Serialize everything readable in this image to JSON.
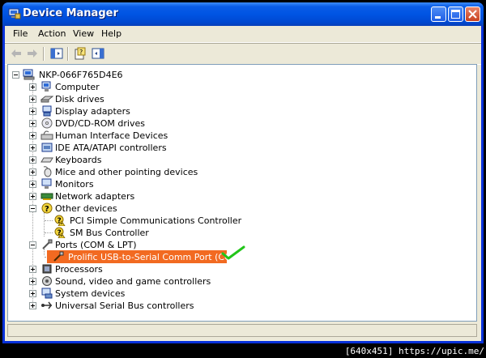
{
  "window": {
    "title": "Device Manager"
  },
  "menu": [
    "File",
    "Action",
    "View",
    "Help"
  ],
  "toolbar": {
    "icons": [
      "back-arrow-icon",
      "forward-arrow-icon",
      "show-hide-tree-icon",
      "properties-help-icon",
      "console-tree-icon"
    ]
  },
  "tree": {
    "root": "NKP-066F765D4E6",
    "items": [
      {
        "label": "Computer",
        "icon": "computer-icon"
      },
      {
        "label": "Disk drives",
        "icon": "disk-drive-icon"
      },
      {
        "label": "Display adapters",
        "icon": "display-adapter-icon"
      },
      {
        "label": "DVD/CD-ROM drives",
        "icon": "cdrom-icon"
      },
      {
        "label": "Human Interface Devices",
        "icon": "hid-icon"
      },
      {
        "label": "IDE ATA/ATAPI controllers",
        "icon": "ide-controller-icon"
      },
      {
        "label": "Keyboards",
        "icon": "keyboard-icon"
      },
      {
        "label": "Mice and other pointing devices",
        "icon": "mouse-icon"
      },
      {
        "label": "Monitors",
        "icon": "monitor-icon"
      },
      {
        "label": "Network adapters",
        "icon": "network-adapter-icon"
      },
      {
        "label": "Other devices",
        "icon": "unknown-device-icon"
      },
      {
        "label": "PCI Simple Communications Controller",
        "icon": "warning-device-icon"
      },
      {
        "label": "SM Bus Controller",
        "icon": "warning-device-icon"
      },
      {
        "label": "Ports (COM & LPT)",
        "icon": "port-icon"
      },
      {
        "label": "Prolific USB-to-Serial Comm Port (COM9)",
        "icon": "serial-port-icon"
      },
      {
        "label": "Processors",
        "icon": "processor-icon"
      },
      {
        "label": "Sound, video and game controllers",
        "icon": "sound-icon"
      },
      {
        "label": "System devices",
        "icon": "system-device-icon"
      },
      {
        "label": "Universal Serial Bus controllers",
        "icon": "usb-icon"
      }
    ]
  },
  "colors": {
    "selection": "#F26A21",
    "titlebar": "#0054E3",
    "checkmark": "#22C51A"
  },
  "watermark": "[640x451] https://upic.me/"
}
